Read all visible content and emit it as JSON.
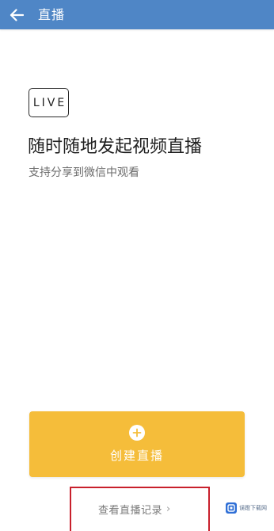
{
  "colors": {
    "app_bar": "#4f86c6",
    "create_button": "#f5bd3a",
    "highlight_border": "#c8202c",
    "watermark_logo": "#2f6fd6"
  },
  "header": {
    "back_icon": "arrow-left-icon",
    "title": "直播"
  },
  "main": {
    "badge": "LIVE",
    "headline": "随时随地发起视频直播",
    "subheadline": "支持分享到微信中观看"
  },
  "create_button": {
    "icon": "plus-circle-icon",
    "label": "创建直播"
  },
  "records_link": {
    "label": "查看直播记录",
    "chevron": "›"
  },
  "watermark": {
    "text": "误蹬下载网"
  }
}
